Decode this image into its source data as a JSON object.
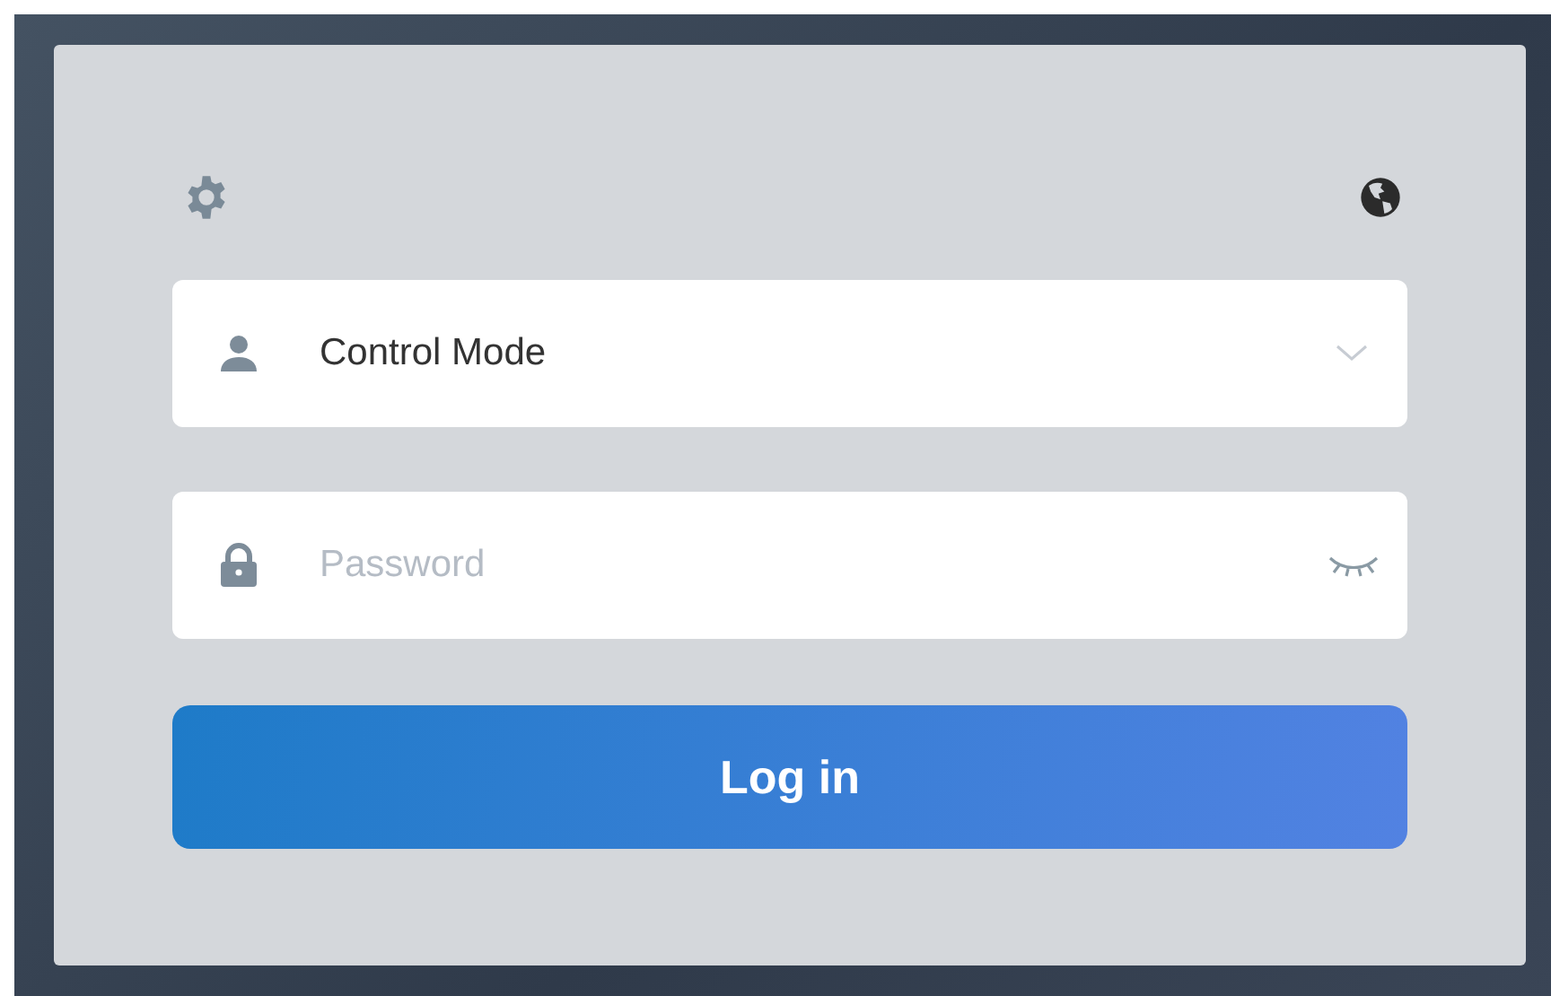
{
  "mode_select": {
    "value": "Control Mode"
  },
  "password": {
    "placeholder": "Password"
  },
  "login_button": {
    "label": "Log in"
  }
}
